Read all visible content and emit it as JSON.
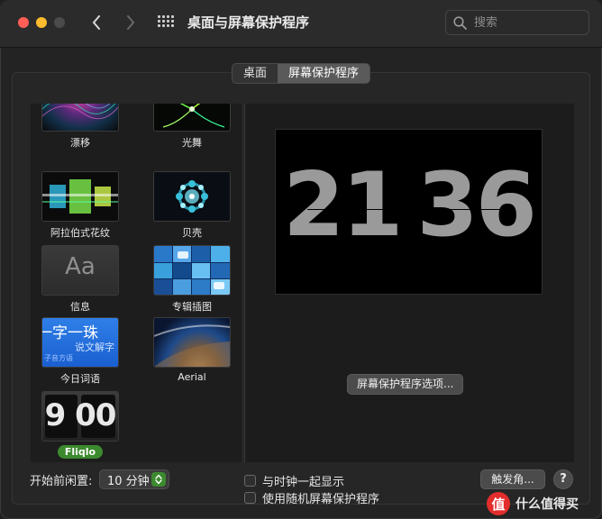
{
  "window": {
    "title": "桌面与屏幕保护程序",
    "search_placeholder": "搜索"
  },
  "tabs": [
    {
      "label": "桌面",
      "active": false
    },
    {
      "label": "屏幕保护程序",
      "active": true
    }
  ],
  "savers": [
    {
      "label": "漂移",
      "thumb": "drift"
    },
    {
      "label": "光舞",
      "thumb": "flurry"
    },
    {
      "label": "阿拉伯式花纹",
      "thumb": "arabesque"
    },
    {
      "label": "贝壳",
      "thumb": "shell"
    },
    {
      "label": "信息",
      "thumb": "message",
      "thumb_text": "Aa"
    },
    {
      "label": "专辑插图",
      "thumb": "album"
    },
    {
      "label": "今日词语",
      "thumb": "word",
      "thumb_text": "一字一珠",
      "thumb_sub": "说文解字",
      "thumb_tiny": "子音方语"
    },
    {
      "label": "Aerial",
      "thumb": "aerial"
    },
    {
      "label": "Fliqlo",
      "thumb": "fliqlo",
      "thumb_text": "9 00",
      "selected": true
    }
  ],
  "preview": {
    "hours": "21",
    "minutes": "36"
  },
  "options_button": "屏幕保护程序选项...",
  "idle": {
    "label": "开始前闲置:",
    "value": "10 分钟"
  },
  "checkboxes": [
    {
      "label": "与时钟一起显示",
      "checked": false
    },
    {
      "label": "使用随机屏幕保护程序",
      "checked": false
    }
  ],
  "hot_corners_button": "触发角...",
  "help_button": "?",
  "watermark": {
    "badge": "值",
    "text": "什么值得买"
  },
  "colors": {
    "accent": "#3c8a2e",
    "close": "#ff5f57",
    "minimize": "#febc2e"
  }
}
